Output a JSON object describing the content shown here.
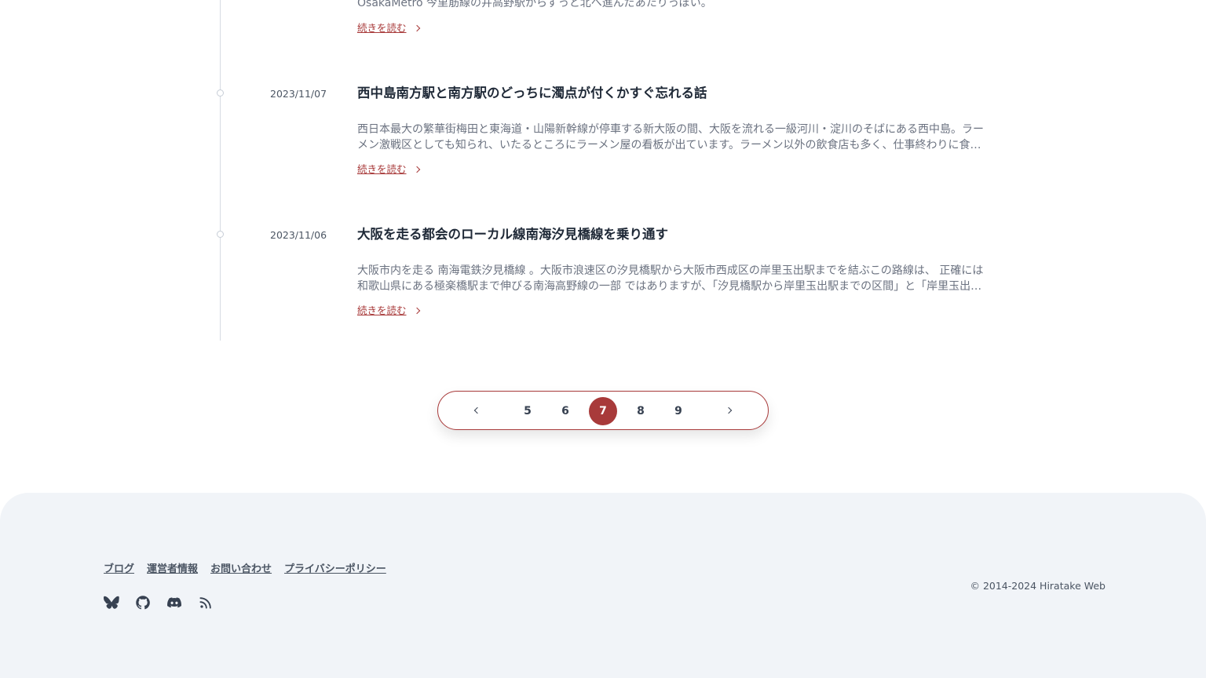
{
  "posts": {
    "top_excerpt": "OsakaMetro 今里筋線の井高野駅からずっと北へ進んだあたりっぽい。",
    "read_more_label": "続きを読む",
    "items": [
      {
        "date": "2023/11/07",
        "title": "西中島南方駅と南方駅のどっちに濁点が付くかすぐ忘れる話",
        "excerpt": "西日本最大の繁華街梅田と東海道・山陽新幹線が停車する新大阪の間、大阪を流れる一級河川・淀川のそばにある西中島。ラーメン激戦区としても知られ、いたるところにラーメン屋の看板が出ています。ラーメン以外の飲食店も多く、仕事終わりに食…"
      },
      {
        "date": "2023/11/06",
        "title": "大阪を走る都会のローカル線南海汐見橋線を乗り通す",
        "excerpt": "大阪市内を走る 南海電鉄汐見橋線 。大阪市浪速区の汐見橋駅から大阪市西成区の岸里玉出駅までを結ぶこの路線は、 正確には和歌山県にある極楽橋駅まで伸びる南海高野線の一部 ではありますが、「汐見橋駅から岸里玉出駅までの区間」と「岸里玉出…"
      }
    ]
  },
  "pagination": {
    "pages": [
      "5",
      "6",
      "7",
      "8",
      "9"
    ],
    "current": "7"
  },
  "footer": {
    "links": [
      "ブログ",
      "運営者情報",
      "お問い合わせ",
      "プライバシーポリシー"
    ],
    "social_icons": [
      "bluesky-icon",
      "github-icon",
      "discord-icon",
      "rss-icon"
    ],
    "copyright": "© 2014-2024 Hiratake Web"
  },
  "colors": {
    "accent": "#a83a3a",
    "footer_bg": "#f1f4f8"
  }
}
